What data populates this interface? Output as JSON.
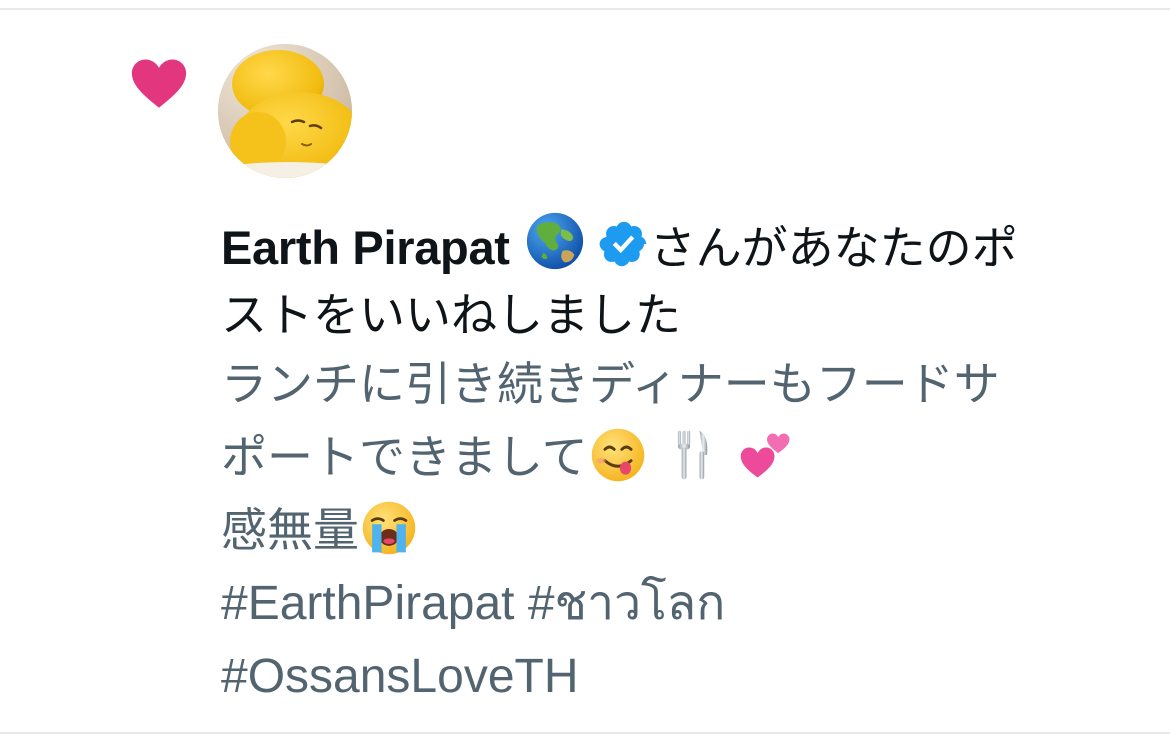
{
  "colors": {
    "like": "#e2367f",
    "verified": "#1d9bf0",
    "text_primary": "#0f1419",
    "text_secondary": "#536471",
    "divider": "#e7e9ec"
  },
  "notification": {
    "icon": "heart-icon",
    "user_name": "Earth Pirapat",
    "user_badges": [
      "globe-asia-icon",
      "verified-badge-icon"
    ],
    "action_line1": "さんがあなたのポ",
    "action_line2": "ストをいいねしました"
  },
  "post": {
    "line1": "ランチに引き続きディナーもフードサ",
    "line2": "ポートできまして",
    "line2_emojis": [
      "savoring-food-emoji",
      "fork-knife-emoji",
      "two-hearts-emoji"
    ],
    "line3": "感無量",
    "line3_emojis": [
      "loudly-crying-emoji"
    ],
    "hashtags_line1": "#EarthPirapat #ชาวโลก",
    "hashtags_line2": "#OssansLoveTH"
  }
}
